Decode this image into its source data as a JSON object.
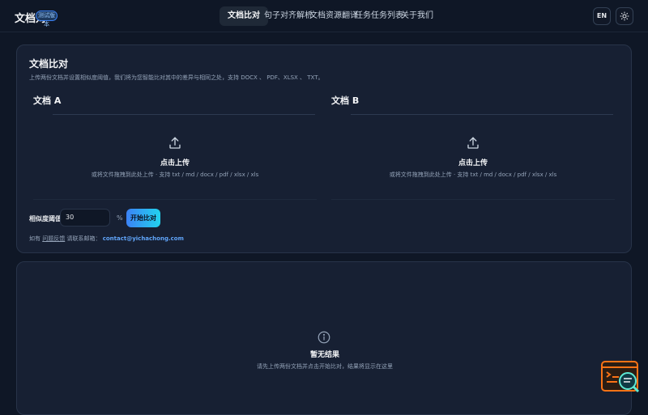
{
  "header": {
    "brand": "文档对",
    "badge": "测试版本",
    "nav": [
      "文档比对",
      "句子对齐解析",
      "文档资源翻译",
      "任务任务列表",
      "关于我们"
    ],
    "lang_label": "EN",
    "theme_icon": "sun-icon"
  },
  "compare": {
    "title": "文档比对",
    "description": "上传两份文档并设置相似度阈值，我们将为您智能比对其中的差异与相同之处，支持 DOCX 、 PDF、XLSX 、 TXT。",
    "doc_a": {
      "heading": "文档 A",
      "upload_label": "点击上传",
      "upload_hint": "或将文件拖拽到此处上传 · 支持 txt / md / docx / pdf / xlsx / xls"
    },
    "doc_b": {
      "heading": "文档 B",
      "upload_label": "点击上传",
      "upload_hint": "或将文件拖拽到此处上传 · 支持 txt / md / docx / pdf / xlsx / xls"
    },
    "threshold_label": "相似度阈值",
    "threshold_value": "30",
    "threshold_unit": "%",
    "submit_label": "开始比对",
    "contact_prefix": "如有",
    "contact_middle": "问题反馈",
    "contact_suffix": "请联系邮箱：",
    "contact_email": "contact@yichachong.com"
  },
  "results": {
    "icon": "info-icon",
    "title": "暂无结果",
    "description": "请先上传两份文档并点击开始比对，结果将显示在这里"
  },
  "colors": {
    "accent": "#3b82f6",
    "accent_end": "#22d3ee",
    "widget": "#f97316"
  }
}
